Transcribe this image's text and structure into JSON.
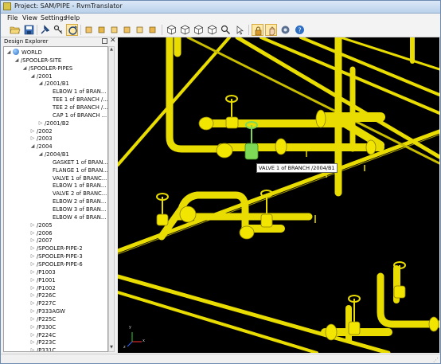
{
  "window": {
    "title": "Project: SAM/PIPE - RvmTranslator"
  },
  "menu": [
    "File",
    "View",
    "Settings",
    "Help"
  ],
  "toolbar": {
    "buttons": [
      "open-file-icon",
      "save-icon",
      "pin-icon",
      "key-icon",
      "rotate-icon",
      "view-front-icon",
      "view-back-icon",
      "view-left-icon",
      "view-right-icon",
      "view-top-icon",
      "view-bottom-icon",
      "view-iso-icon",
      "cube-view-icon",
      "cube-view-2-icon",
      "cube-view-3-icon",
      "cube-view-4-icon",
      "zoom-icon",
      "select-tool-icon",
      "lock-icon",
      "hand-icon",
      "settings-icon",
      "help-icon"
    ]
  },
  "panel": {
    "title": "Design Explorer",
    "tree": [
      {
        "label": "WORLD",
        "depth": 0,
        "state": "open",
        "icon": "globe"
      },
      {
        "label": "/SPOOLER-SITE",
        "depth": 1,
        "state": "open"
      },
      {
        "label": "/SPOOLER-PIPES",
        "depth": 2,
        "state": "open"
      },
      {
        "label": "/2001",
        "depth": 3,
        "state": "open"
      },
      {
        "label": "/2001/B1",
        "depth": 4,
        "state": "open"
      },
      {
        "label": "ELBOW 1 of BRAN...",
        "depth": 5,
        "state": "leaf"
      },
      {
        "label": "TEE 1 of BRANCH /...",
        "depth": 5,
        "state": "leaf"
      },
      {
        "label": "TEE 2 of BRANCH /...",
        "depth": 5,
        "state": "leaf"
      },
      {
        "label": "CAP 1 of BRANCH ...",
        "depth": 5,
        "state": "leaf"
      },
      {
        "label": "/2001/B2",
        "depth": 4,
        "state": "closed"
      },
      {
        "label": "/2002",
        "depth": 3,
        "state": "closed"
      },
      {
        "label": "/2003",
        "depth": 3,
        "state": "closed"
      },
      {
        "label": "/2004",
        "depth": 3,
        "state": "open"
      },
      {
        "label": "/2004/B1",
        "depth": 4,
        "state": "open"
      },
      {
        "label": "GASKET 1 of BRAN...",
        "depth": 5,
        "state": "leaf"
      },
      {
        "label": "FLANGE 1 of BRAN...",
        "depth": 5,
        "state": "leaf"
      },
      {
        "label": "VALVE 1 of BRANC...",
        "depth": 5,
        "state": "leaf"
      },
      {
        "label": "ELBOW 1 of BRAN...",
        "depth": 5,
        "state": "leaf"
      },
      {
        "label": "VALVE 2 of BRANC...",
        "depth": 5,
        "state": "leaf"
      },
      {
        "label": "ELBOW 2 of BRAN...",
        "depth": 5,
        "state": "leaf"
      },
      {
        "label": "ELBOW 3 of BRAN...",
        "depth": 5,
        "state": "leaf"
      },
      {
        "label": "ELBOW 4 of BRAN...",
        "depth": 5,
        "state": "leaf"
      },
      {
        "label": "/2005",
        "depth": 3,
        "state": "closed"
      },
      {
        "label": "/2006",
        "depth": 3,
        "state": "closed"
      },
      {
        "label": "/2007",
        "depth": 3,
        "state": "closed"
      },
      {
        "label": "/SPOOLER-PIPE-2",
        "depth": 3,
        "state": "closed"
      },
      {
        "label": "/SPOOLER-PIPE-3",
        "depth": 3,
        "state": "closed"
      },
      {
        "label": "/SPOOLER-PIPE-6",
        "depth": 3,
        "state": "closed"
      },
      {
        "label": "/P1003",
        "depth": 3,
        "state": "closed"
      },
      {
        "label": "/P1001",
        "depth": 3,
        "state": "closed"
      },
      {
        "label": "/P1002",
        "depth": 3,
        "state": "closed"
      },
      {
        "label": "/P226C",
        "depth": 3,
        "state": "closed"
      },
      {
        "label": "/P227C",
        "depth": 3,
        "state": "closed"
      },
      {
        "label": "/P333AGW",
        "depth": 3,
        "state": "closed"
      },
      {
        "label": "/P225C",
        "depth": 3,
        "state": "closed"
      },
      {
        "label": "/P330C",
        "depth": 3,
        "state": "closed"
      },
      {
        "label": "/P224C",
        "depth": 3,
        "state": "closed"
      },
      {
        "label": "/P223C",
        "depth": 3,
        "state": "closed"
      },
      {
        "label": "/P331C",
        "depth": 3,
        "state": "closed"
      }
    ]
  },
  "viewport": {
    "tooltip": "VALVE 1 of BRANCH /2004/B1",
    "axes": {
      "x": "x",
      "y": "y",
      "z": "z"
    },
    "colors": {
      "background": "#000000",
      "pipe": "#f2e600",
      "selected": "#7ed957"
    }
  }
}
